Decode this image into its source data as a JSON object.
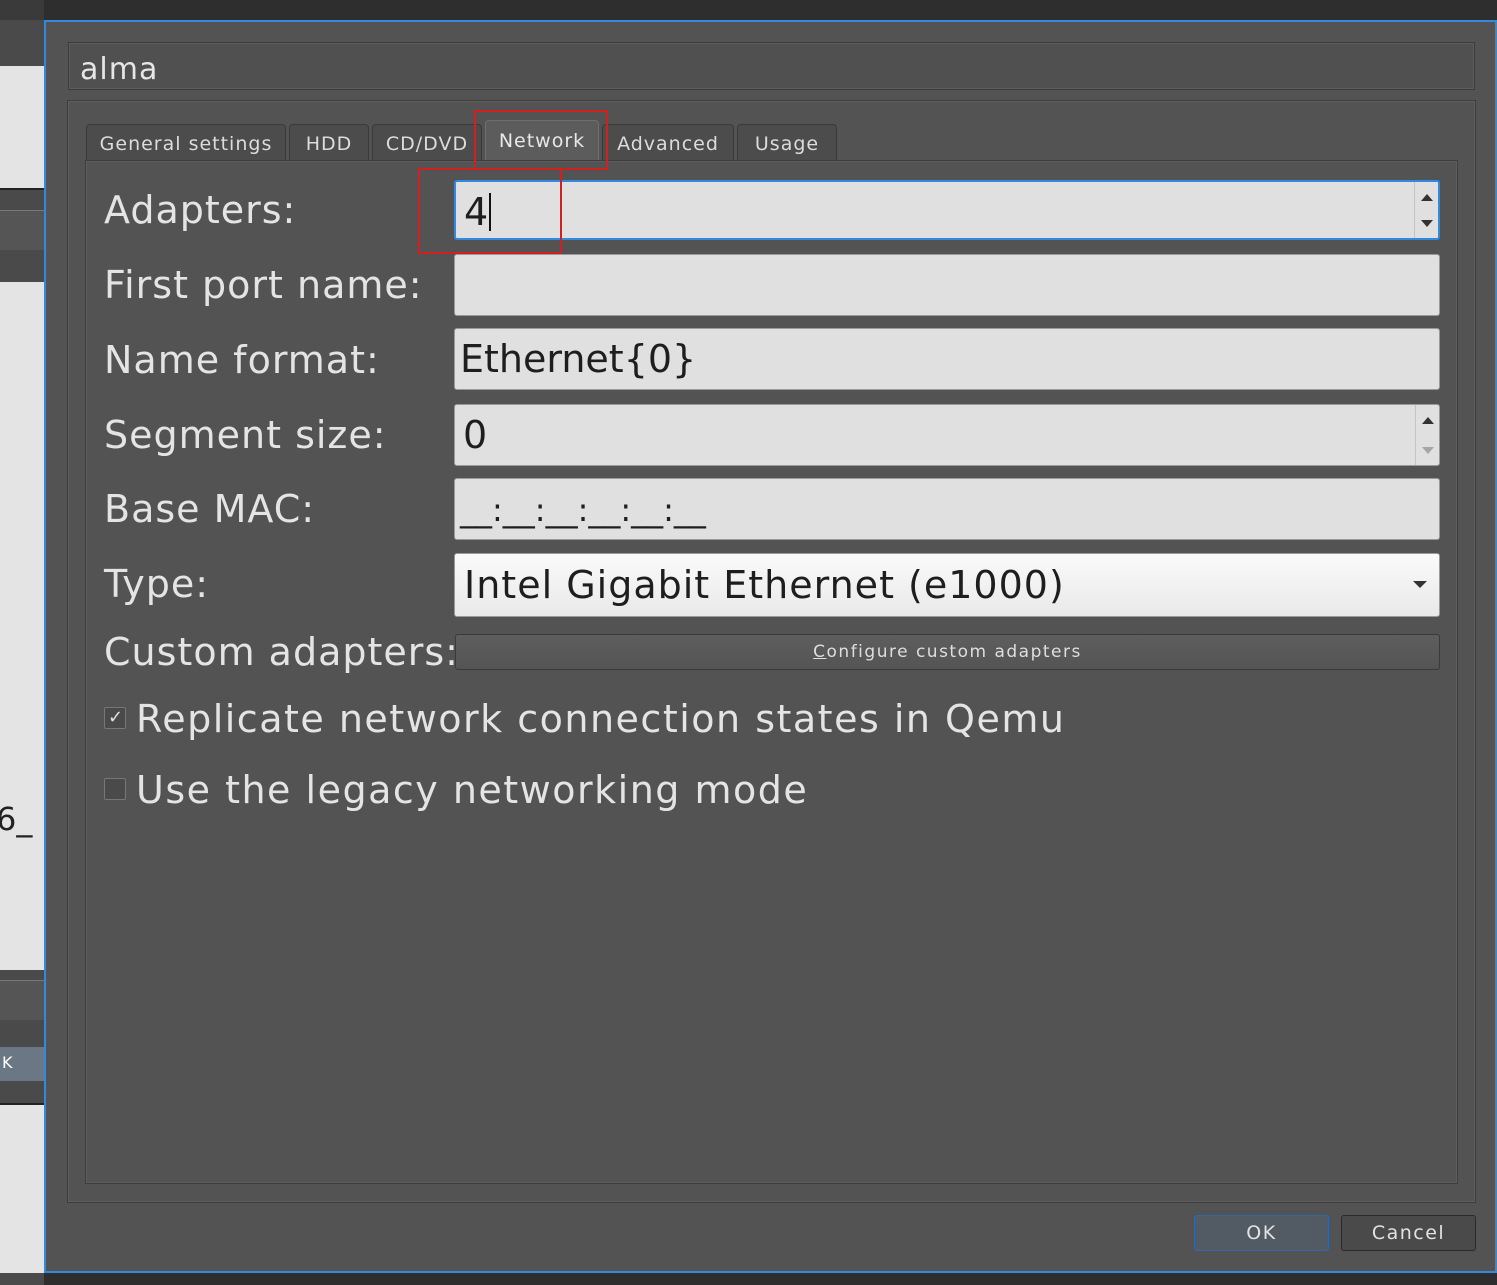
{
  "dialog": {
    "title": "alma"
  },
  "tabs": [
    {
      "label": "General settings"
    },
    {
      "label": "HDD"
    },
    {
      "label": "CD/DVD"
    },
    {
      "label": "Network"
    },
    {
      "label": "Advanced"
    },
    {
      "label": "Usage"
    }
  ],
  "active_tab": "Network",
  "network": {
    "adapters_label": "Adapters:",
    "adapters_value": "4",
    "first_port_label": "First port name:",
    "first_port_value": "",
    "name_format_label": "Name format:",
    "name_format_value": "Ethernet{0}",
    "segment_size_label": "Segment size:",
    "segment_size_value": "0",
    "base_mac_label": "Base MAC:",
    "base_mac_value": "__:__:__:__:__:__",
    "type_label": "Type:",
    "type_value": "Intel Gigabit Ethernet (e1000)",
    "custom_adapters_label": "Custom adapters:",
    "configure_button_prefix": "C",
    "configure_button_rest": "onfigure custom adapters",
    "replicate_label": "Replicate network connection states in Qemu",
    "replicate_checked": true,
    "legacy_label": "Use the legacy networking mode",
    "legacy_checked": false,
    "checkmark": "✓"
  },
  "buttons": {
    "ok": "OK",
    "cancel": "Cancel"
  },
  "background": {
    "partial_text": "6_",
    "partial_button": "K"
  },
  "colors": {
    "focus_border": "#2f8ae0",
    "annotation_box": "#d02020",
    "dialog_bg": "#535353"
  }
}
